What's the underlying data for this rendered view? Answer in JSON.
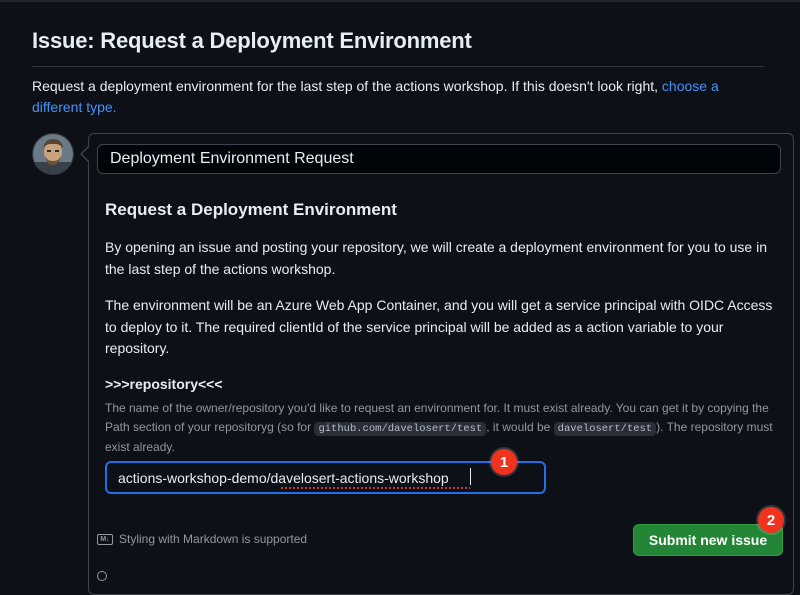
{
  "page": {
    "title": "Issue: Request a Deployment Environment",
    "description_text": "Request a deployment environment for the last step of the actions workshop. If this doesn't look right, ",
    "description_link": "choose a different type."
  },
  "issue_title_input": {
    "value": "Deployment Environment Request"
  },
  "form": {
    "heading": "Request a Deployment Environment",
    "paragraph_1": "By opening an issue and posting your repository, we will create a deployment environment for you to use in the last step of the actions workshop.",
    "paragraph_2": "The environment will be an Azure Web App Container, and you will get a service principal with OIDC Access to deploy to it. The required clientId of the service principal will be added as a action variable to your repository.",
    "field_label": ">>>repository<<<",
    "help_part_1": "The name of the owner/repository you'd like to request an environment for. It must exist already. You can get it by copying the Path section of your repositoryg (so for ",
    "help_code_1": "github.com/davelosert/test",
    "help_part_2": ", it would be ",
    "help_code_2": "davelosert/test",
    "help_part_3": "). The repository must exist already.",
    "repo_input_value": "actions-workshop-demo/davelosert-actions-workshop"
  },
  "footer": {
    "markdown_hint": "Styling with Markdown is supported",
    "markdown_icon_text": "M↓",
    "submit_label": "Submit new issue"
  },
  "annotations": {
    "badge_1": "1",
    "badge_2": "2"
  },
  "colors": {
    "background": "#0d1117",
    "link": "#4493f8",
    "primary_button": "#238636",
    "focus_border": "#1f6feb",
    "annotation_badge": "#f0331f"
  }
}
